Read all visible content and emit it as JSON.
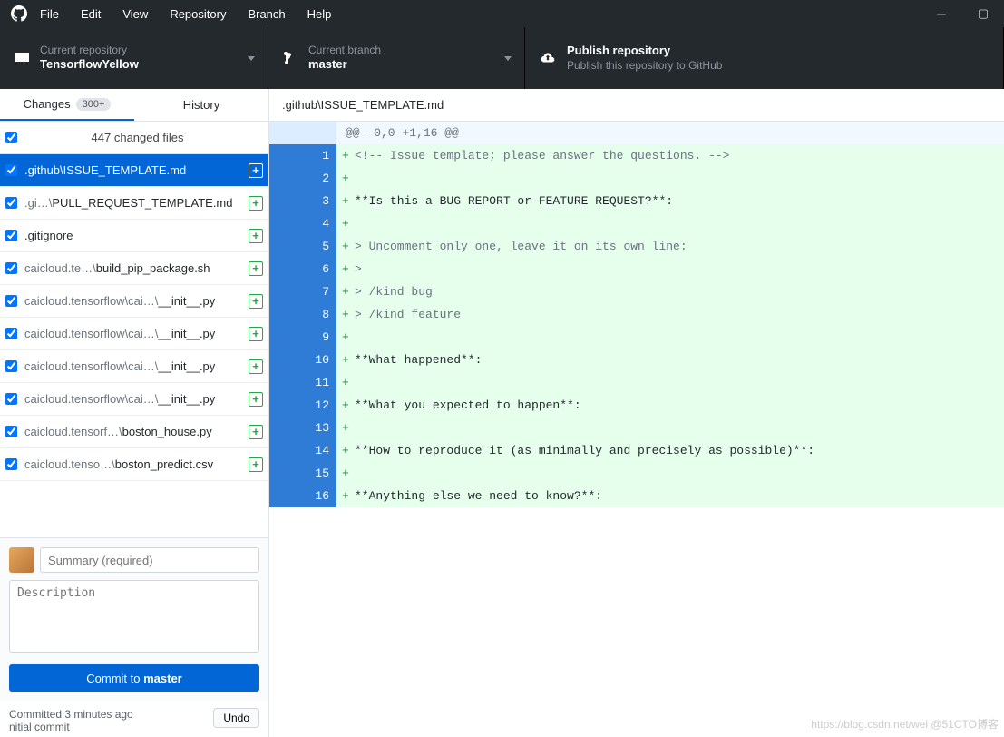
{
  "menu": [
    "File",
    "Edit",
    "View",
    "Repository",
    "Branch",
    "Help"
  ],
  "toolbar": {
    "repo": {
      "sub": "Current repository",
      "name": "TensorflowYellow"
    },
    "branch": {
      "sub": "Current branch",
      "name": "master"
    },
    "publish": {
      "title": "Publish repository",
      "sub": "Publish this repository to GitHub"
    }
  },
  "side": {
    "tabs": {
      "changes": "Changes",
      "changes_count": "300+",
      "history": "History"
    },
    "changed_bar": "447 changed files",
    "files": [
      {
        "pre": "",
        "dim": "",
        "name": ".github\\ISSUE_TEMPLATE.md",
        "selected": true
      },
      {
        "pre": "",
        "dim": ".gi…\\",
        "name": "PULL_REQUEST_TEMPLATE.md"
      },
      {
        "pre": "",
        "dim": "",
        "name": ".gitignore"
      },
      {
        "pre": "",
        "dim": "caicloud.te…\\",
        "name": "build_pip_package.sh"
      },
      {
        "pre": "",
        "dim": "caicloud.tensorflow\\cai…\\",
        "name": "__init__.py"
      },
      {
        "pre": "",
        "dim": "caicloud.tensorflow\\cai…\\",
        "name": "__init__.py"
      },
      {
        "pre": "",
        "dim": "caicloud.tensorflow\\cai…\\",
        "name": "__init__.py"
      },
      {
        "pre": "",
        "dim": "caicloud.tensorflow\\cai…\\",
        "name": "__init__.py"
      },
      {
        "pre": "",
        "dim": "caicloud.tensorf…\\",
        "name": "boston_house.py"
      },
      {
        "pre": "",
        "dim": "caicloud.tenso…\\",
        "name": "boston_predict.csv"
      }
    ]
  },
  "commit": {
    "summary_ph": "Summary (required)",
    "desc_ph": "Description",
    "btn_pre": "Commit to ",
    "btn_branch": "master",
    "last_line1": "Committed 3 minutes ago",
    "last_line2": "nitial commit",
    "undo": "Undo"
  },
  "diff": {
    "path": ".github\\ISSUE_TEMPLATE.md",
    "hunk": "@@ -0,0 +1,16 @@",
    "lines": [
      {
        "n": 1,
        "raw": "<!-- Issue template; please answer the questions. -->",
        "cls": "cmt"
      },
      {
        "n": 2,
        "raw": ""
      },
      {
        "n": 3,
        "raw": "**Is this a BUG REPORT or FEATURE REQUEST?**:"
      },
      {
        "n": 4,
        "raw": ""
      },
      {
        "n": 5,
        "raw": "> Uncomment only one, leave it on its own line:",
        "cls": "cmt"
      },
      {
        "n": 6,
        "raw": ">",
        "cls": "cmt"
      },
      {
        "n": 7,
        "raw": "> /kind bug",
        "cls": "cmt"
      },
      {
        "n": 8,
        "raw": "> /kind feature",
        "cls": "cmt"
      },
      {
        "n": 9,
        "raw": ""
      },
      {
        "n": 10,
        "raw": "**What happened**:"
      },
      {
        "n": 11,
        "raw": ""
      },
      {
        "n": 12,
        "raw": "**What you expected to happen**:"
      },
      {
        "n": 13,
        "raw": ""
      },
      {
        "n": 14,
        "raw": "**How to reproduce it (as minimally and precisely as possible)**:"
      },
      {
        "n": 15,
        "raw": ""
      },
      {
        "n": 16,
        "raw": "**Anything else we need to know?**:"
      }
    ]
  },
  "watermark": "https://blog.csdn.net/wei @51CTO博客"
}
